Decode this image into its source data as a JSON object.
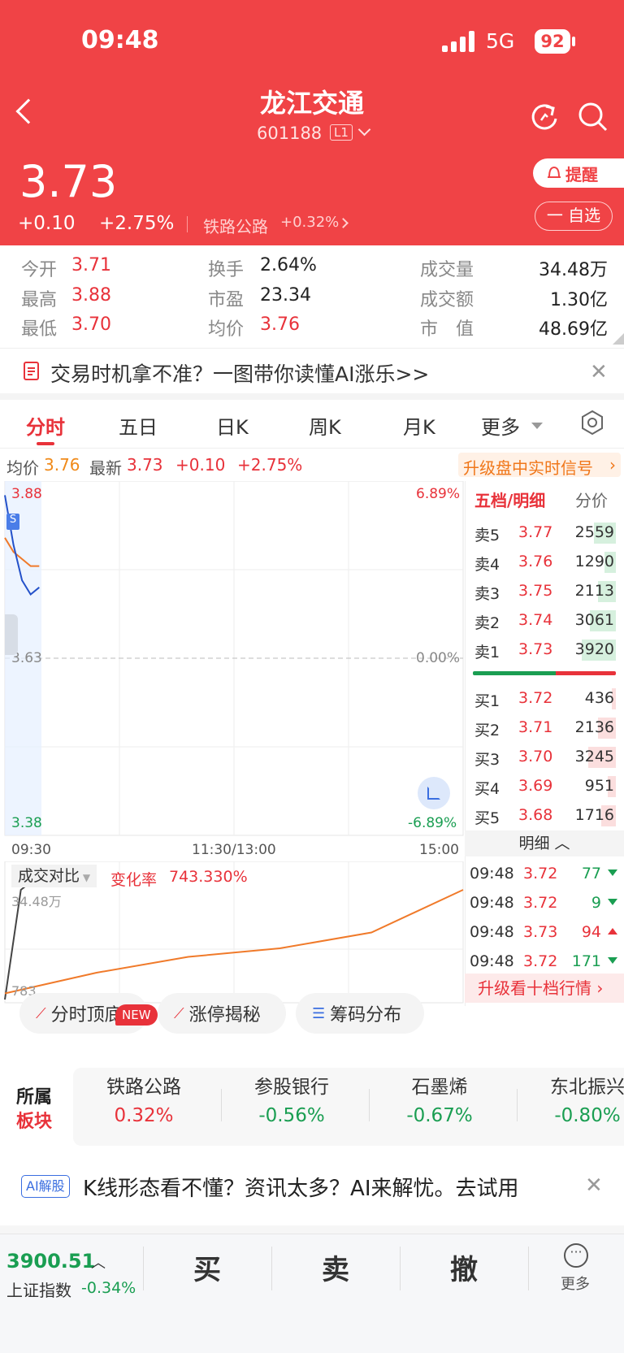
{
  "status_bar": {
    "time": "09:48",
    "network": "5G",
    "battery": "92"
  },
  "header": {
    "stock_name": "龙江交通",
    "stock_code": "601188",
    "level": "L1",
    "price": "3.73",
    "change": "+0.10",
    "change_pct": "+2.75%",
    "sector": "铁路公路",
    "sector_pct": "+0.32%",
    "alert_label": "提醒",
    "watch_label": "一 自选"
  },
  "stats": [
    {
      "l1": "今开",
      "v1": "3.71",
      "l2": "换手",
      "v2": "2.64%",
      "l3": "成交量",
      "v3": "34.48万"
    },
    {
      "l1": "最高",
      "v1": "3.88",
      "l2": "市盈",
      "v2": "23.34",
      "l3": "成交额",
      "v3": "1.30亿"
    },
    {
      "l1": "最低",
      "v1": "3.70",
      "l2": "均价",
      "v2": "3.76",
      "l3": "市　值",
      "v3": "48.69亿"
    }
  ],
  "promo_banner": "交易时机拿不准？一图带你读懂AI涨乐>>",
  "tabs": [
    "分时",
    "五日",
    "日K",
    "周K",
    "月K",
    "更多"
  ],
  "quote_line": {
    "avg_label": "均价",
    "avg": "3.76",
    "latest_label": "最新",
    "latest": "3.73",
    "change": "+0.10",
    "pct": "+2.75%",
    "upgrade": "升级盘中实时信号"
  },
  "chart_axis": {
    "high": "3.88",
    "mid": "3.63",
    "low": "3.38",
    "high_pct": "6.89%",
    "mid_pct": "0.00%",
    "low_pct": "-6.89%",
    "t_start": "09:30",
    "t_mid": "11:30/13:00",
    "t_end": "15:00"
  },
  "chart_data": {
    "type": "line",
    "x": [
      "09:30",
      "09:35",
      "09:40",
      "09:45",
      "09:48"
    ],
    "ylim": [
      3.38,
      3.88
    ],
    "series": [
      {
        "values": [
          3.86,
          3.79,
          3.74,
          3.72,
          3.73
        ]
      },
      {
        "values": [
          3.8,
          3.78,
          3.77,
          3.76,
          3.76
        ]
      }
    ]
  },
  "vol_chart": {
    "title": "成交对比",
    "change_label": "变化率",
    "change_value": "743.330%",
    "top_label": "34.48万",
    "bottom_label": "783"
  },
  "vol_chart_data": {
    "type": "line",
    "x": [
      "09:30",
      "10:00",
      "11:00",
      "13:00",
      "14:00",
      "15:00"
    ],
    "series": [
      {
        "values": [
          0,
          0.9,
          1.0,
          1.0,
          1.0,
          1.0
        ]
      },
      {
        "values": [
          0.05,
          0.22,
          0.35,
          0.42,
          0.55,
          0.9
        ]
      }
    ]
  },
  "order_book": {
    "tab_active": "五档/明细",
    "tab_other": "分价",
    "sells": [
      {
        "label": "卖5",
        "price": "3.77",
        "vol": "2559",
        "ratio": 0.34
      },
      {
        "label": "卖4",
        "price": "3.76",
        "vol": "1290",
        "ratio": 0.18
      },
      {
        "label": "卖3",
        "price": "3.75",
        "vol": "2113",
        "ratio": 0.28
      },
      {
        "label": "卖2",
        "price": "3.74",
        "vol": "3061",
        "ratio": 0.4
      },
      {
        "label": "卖1",
        "price": "3.73",
        "vol": "3920",
        "ratio": 0.52
      }
    ],
    "buys": [
      {
        "label": "买1",
        "price": "3.72",
        "vol": "436",
        "ratio": 0.06
      },
      {
        "label": "买2",
        "price": "3.71",
        "vol": "2136",
        "ratio": 0.28
      },
      {
        "label": "买3",
        "price": "3.70",
        "vol": "3245",
        "ratio": 0.42
      },
      {
        "label": "买4",
        "price": "3.69",
        "vol": "951",
        "ratio": 0.12
      },
      {
        "label": "买5",
        "price": "3.68",
        "vol": "1716",
        "ratio": 0.22
      }
    ],
    "detail_label": "明细",
    "ticks": [
      {
        "time": "09:48",
        "price": "3.72",
        "vol": "77",
        "dir": "down"
      },
      {
        "time": "09:48",
        "price": "3.72",
        "vol": "9",
        "dir": "down"
      },
      {
        "time": "09:48",
        "price": "3.73",
        "vol": "94",
        "dir": "up"
      },
      {
        "time": "09:48",
        "price": "3.72",
        "vol": "171",
        "dir": "down"
      }
    ],
    "upgrade": "升级看十档行情"
  },
  "tools": [
    {
      "label": "分时顶底",
      "badge": "NEW"
    },
    {
      "label": "涨停揭秘"
    },
    {
      "label": "筹码分布"
    }
  ],
  "sectors": {
    "label_top": "所属",
    "label_bottom": "板块",
    "items": [
      {
        "name": "铁路公路",
        "pct": "0.32%",
        "up": true
      },
      {
        "name": "参股银行",
        "pct": "-0.56%",
        "up": false
      },
      {
        "name": "石墨烯",
        "pct": "-0.67%",
        "up": false
      },
      {
        "name": "东北振兴",
        "pct": "-0.80%",
        "up": false
      }
    ]
  },
  "ai_banner": {
    "tag": "AI解股",
    "text": "K线形态看不懂？资讯太多？AI来解忧。去试用"
  },
  "bottom_bar": {
    "index_value": "3900.51",
    "index_name": "上证指数",
    "index_pct": "-0.34%",
    "buy": "买",
    "sell": "卖",
    "cancel": "撤",
    "more": "更多"
  },
  "colors": {
    "header_red": "#f04346",
    "up_red": "#e8323a",
    "down_green": "#1a9e52"
  }
}
